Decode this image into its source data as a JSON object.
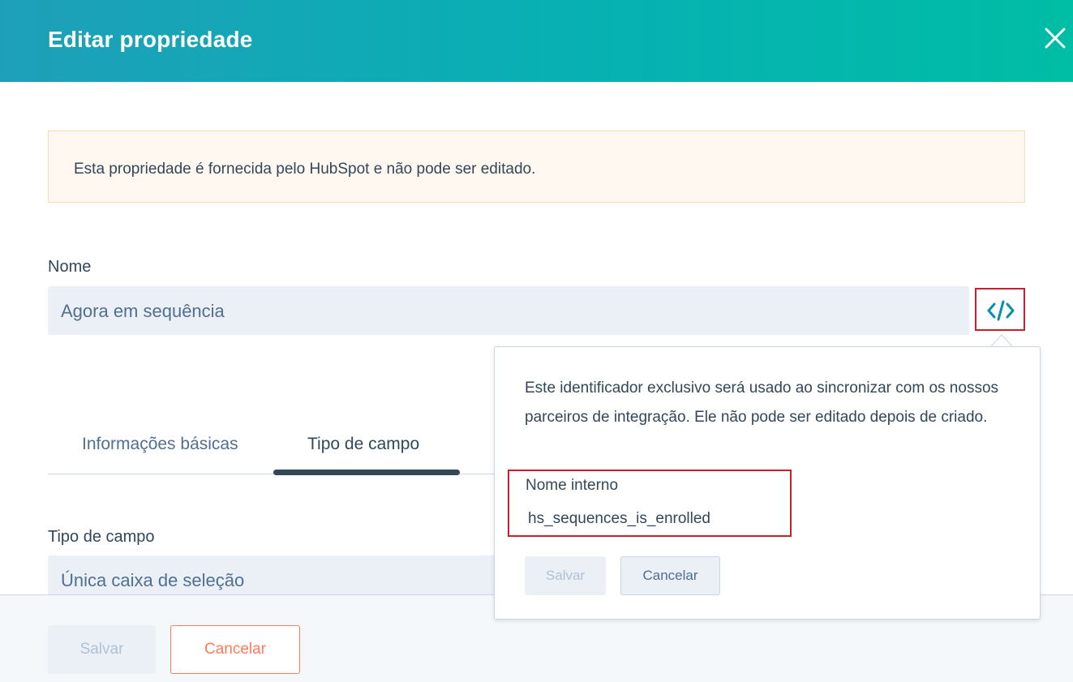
{
  "header": {
    "title": "Editar propriedade",
    "close_icon": "close-icon"
  },
  "alert": {
    "text": "Esta propriedade é fornecida pelo HubSpot e não pode ser editado."
  },
  "name_field": {
    "label": "Nome",
    "value": "Agora em sequência"
  },
  "code_button": {
    "icon": "code-brackets-icon"
  },
  "tabs": [
    {
      "label": "Informações básicas",
      "active": false
    },
    {
      "label": "Tipo de campo",
      "active": true
    }
  ],
  "field_type": {
    "label": "Tipo de campo",
    "value": "Única caixa de seleção"
  },
  "footer": {
    "save_label": "Salvar",
    "cancel_label": "Cancelar"
  },
  "popover": {
    "description": "Este identificador exclusivo será usado ao sincronizar com os nossos parceiros de integração. Ele não pode ser editado depois de criado.",
    "internal_name_label": "Nome interno",
    "internal_name_value": "hs_sequences_is_enrolled",
    "save_label": "Salvar",
    "cancel_label": "Cancelar"
  },
  "colors": {
    "accent_teal": "#00bda5",
    "text": "#33475b",
    "highlight_red": "#c8202f",
    "orange": "#ff7a59"
  }
}
